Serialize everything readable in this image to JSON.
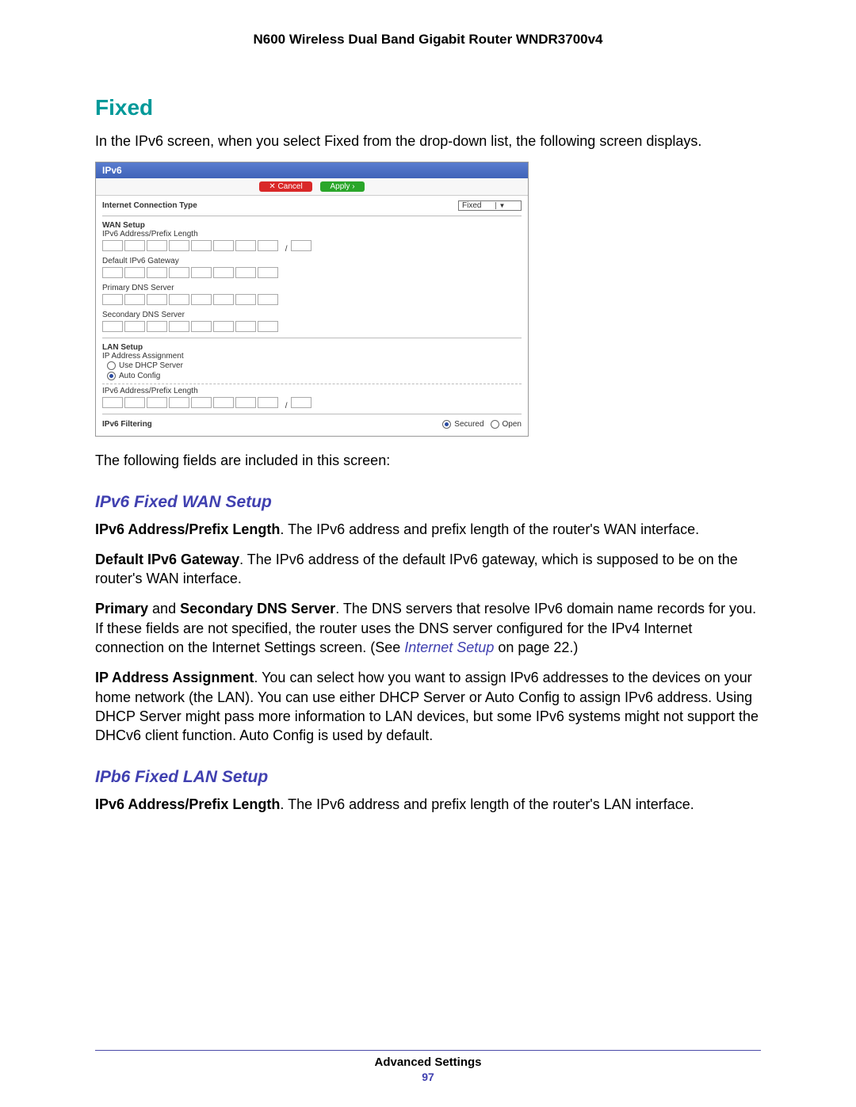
{
  "doc_header": "N600 Wireless Dual Band Gigabit Router WNDR3700v4",
  "section_title": "Fixed",
  "intro": "In the IPv6 screen, when you select Fixed from the drop-down list, the following screen displays.",
  "screenshot": {
    "title": "IPv6",
    "cancel": "Cancel",
    "apply": "Apply",
    "internet_connection_type_label": "Internet Connection Type",
    "internet_connection_type_value": "Fixed",
    "wan_setup": "WAN Setup",
    "ipv6_address_prefix": "IPv6 Address/Prefix Length",
    "default_gateway": "Default IPv6 Gateway",
    "primary_dns": "Primary DNS Server",
    "secondary_dns": "Secondary DNS Server",
    "lan_setup": "LAN Setup",
    "ip_assignment": "IP Address Assignment",
    "use_dhcp": "Use DHCP Server",
    "auto_config": "Auto Config",
    "ipv6_filtering": "IPv6 Filtering",
    "secured": "Secured",
    "open": "Open"
  },
  "following_fields": "The following fields are included in this screen:",
  "wan": {
    "heading": "IPv6 Fixed WAN Setup",
    "p1_label": "IPv6 Address/Prefix Length",
    "p1_text": ". The IPv6 address and prefix length of the router's WAN interface.",
    "p2_label": "Default IPv6 Gateway",
    "p2_text": ". The IPv6 address of the default IPv6 gateway, which is supposed to be on the router's WAN interface.",
    "p3_label1": "Primary",
    "p3_and": " and ",
    "p3_label2": "Secondary DNS Server",
    "p3_text_a": ". The DNS servers that resolve IPv6 domain name records for you. If these fields are not specified, the router uses the DNS server configured for the IPv4 Internet connection on the Internet Settings screen. (See ",
    "p3_link": "Internet Setup",
    "p3_text_b": " on page 22.)",
    "p4_label": "IP Address Assignment",
    "p4_text": ". You can select how you want to assign IPv6 addresses to the devices on your home network (the LAN). You can use either DHCP Server or Auto Config to assign IPv6 address. Using DHCP Server might pass more information to LAN devices, but some IPv6 systems might not support the DHCv6 client function. Auto Config is used by default."
  },
  "lan": {
    "heading": "IPb6 Fixed LAN Setup",
    "p1_label": "IPv6 Address/Prefix Length",
    "p1_text": ". The IPv6 address and prefix length of the router's LAN interface."
  },
  "footer_title": "Advanced Settings",
  "footer_page": "97"
}
